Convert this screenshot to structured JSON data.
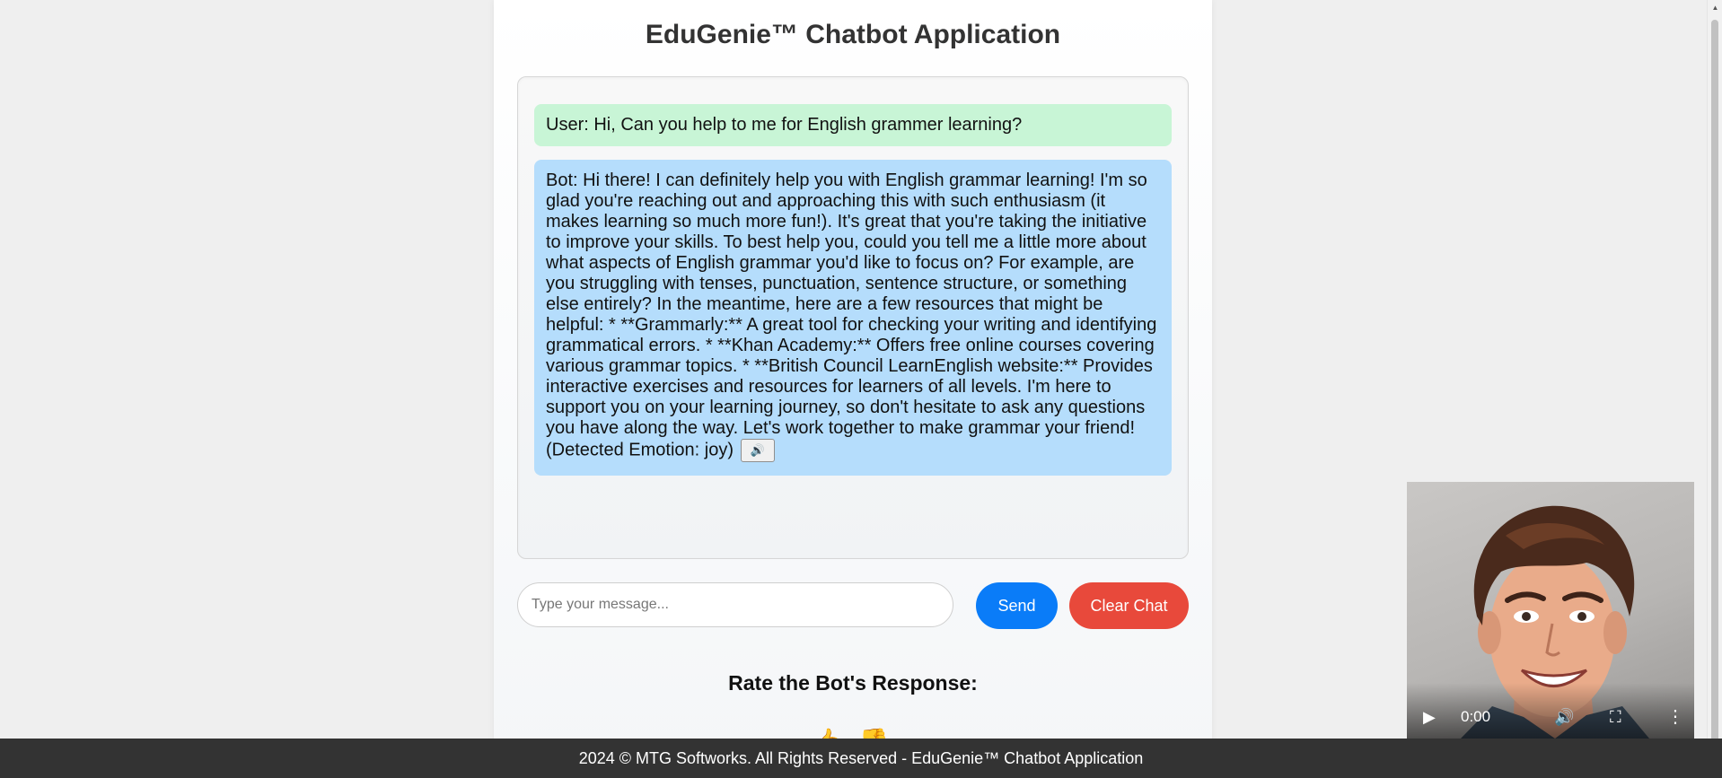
{
  "app": {
    "title": "EduGenie™ Chatbot Application"
  },
  "chat": {
    "messages": [
      {
        "role": "user",
        "text": "User: Hi, Can you help to me for English grammer learning?"
      },
      {
        "role": "bot",
        "text": "Bot: Hi there! I can definitely help you with English grammar learning! I'm so glad you're reaching out and approaching this with such enthusiasm (it makes learning so much more fun!). It's great that you're taking the initiative to improve your skills. To best help you, could you tell me a little more about what aspects of English grammar you'd like to focus on? For example, are you struggling with tenses, punctuation, sentence structure, or something else entirely? In the meantime, here are a few resources that might be helpful: * **Grammarly:** A great tool for checking your writing and identifying grammatical errors. * **Khan Academy:** Offers free online courses covering various grammar topics. * **British Council LearnEnglish website:** Provides interactive exercises and resources for learners of all levels. I'm here to support you on your learning journey, so don't hesitate to ask any questions you have along the way. Let's work together to make grammar your friend! (Detected Emotion: joy)",
        "speak_icon": "🔊"
      }
    ]
  },
  "input": {
    "placeholder": "Type your message...",
    "value": ""
  },
  "buttons": {
    "send": "Send",
    "clear": "Clear Chat"
  },
  "rating": {
    "title": "Rate the Bot's Response:",
    "icons": [
      "👍",
      "👎"
    ]
  },
  "video": {
    "time": "0:00",
    "icons": {
      "play": "▶",
      "volume": "🔊",
      "fullscreen": "⛶",
      "more": "⋮"
    }
  },
  "footer": {
    "text": "2024 © MTG Softworks. All Rights Reserved - EduGenie™ Chatbot Application"
  },
  "colors": {
    "send_button": "#0a7cf8",
    "clear_button": "#e8493b",
    "user_bubble": "#c8f5d6",
    "bot_bubble": "#b5ddfc",
    "footer_bg": "#333333"
  }
}
